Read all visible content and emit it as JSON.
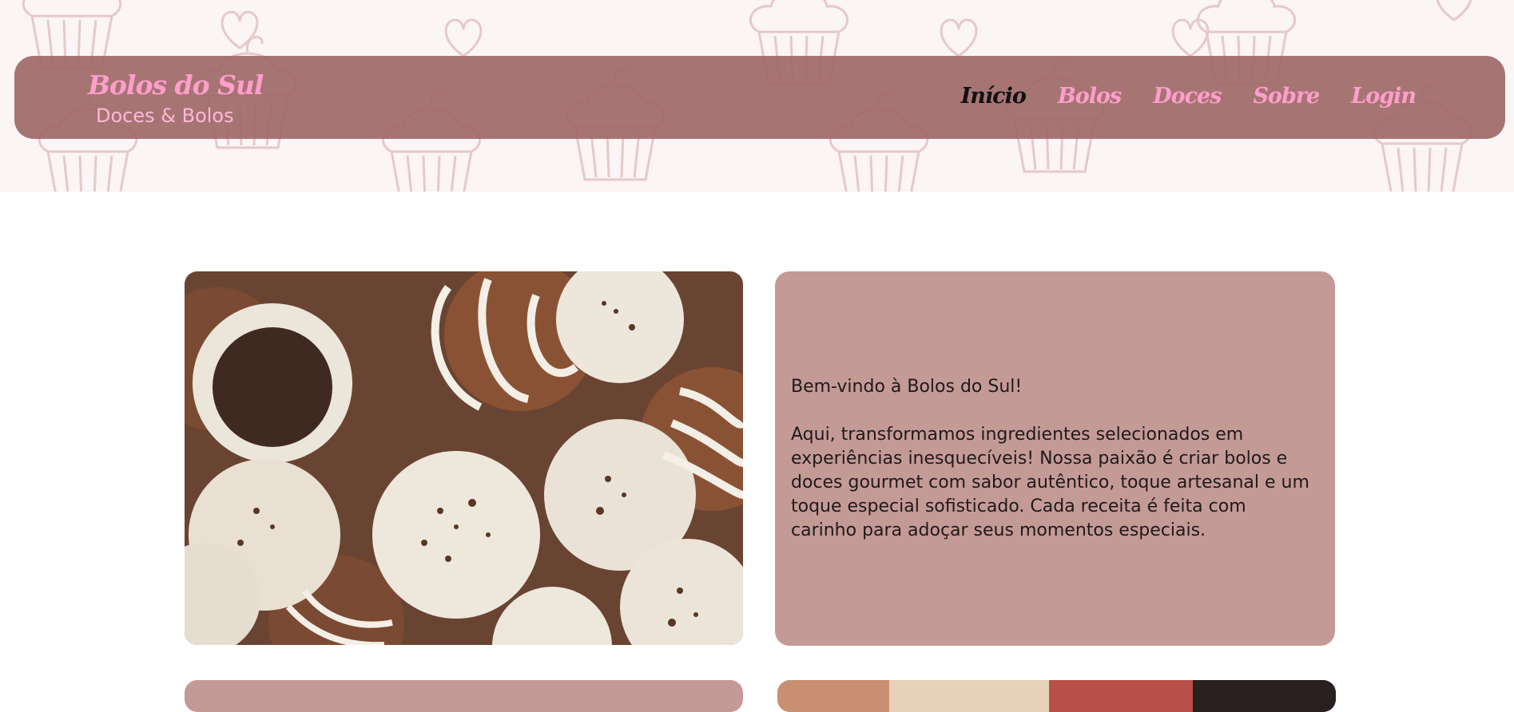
{
  "header": {
    "brand_name": "Bolos do Sul",
    "brand_tagline": "Doces & Bolos"
  },
  "nav": {
    "items": [
      {
        "label": "Início",
        "active": true
      },
      {
        "label": "Bolos",
        "active": false
      },
      {
        "label": "Doces",
        "active": false
      },
      {
        "label": "Sobre",
        "active": false
      },
      {
        "label": "Login",
        "active": false
      }
    ]
  },
  "intro": {
    "welcome": "Bem-vindo à Bolos do Sul!",
    "body": "Aqui, transformamos ingredientes selecionados em experiências inesquecíveis! Nossa paixão é criar bolos e doces gourmet com sabor autêntico, toque artesanal e um toque especial sofisticado. Cada receita é feita com carinho para adoçar seus momentos especiais."
  },
  "colors": {
    "navbar_bg": "#a06969",
    "brand_pink": "#ff9ecb",
    "active_link": "#111111",
    "card_bg": "#c49a97"
  }
}
